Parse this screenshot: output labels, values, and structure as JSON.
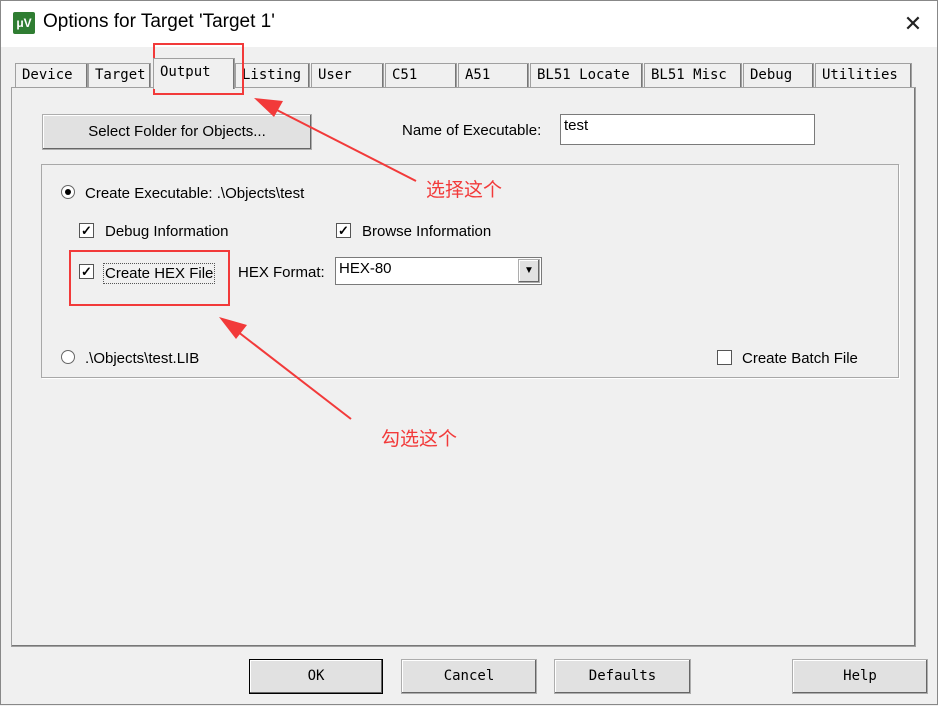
{
  "window": {
    "title": "Options for Target 'Target 1'",
    "icon": "uvision-icon",
    "close": "✕"
  },
  "tabs": [
    {
      "label": "Device",
      "selected": false
    },
    {
      "label": "Target",
      "selected": false
    },
    {
      "label": "Output",
      "selected": true
    },
    {
      "label": "Listing",
      "selected": false
    },
    {
      "label": "User",
      "selected": false
    },
    {
      "label": "C51",
      "selected": false
    },
    {
      "label": "A51",
      "selected": false
    },
    {
      "label": "BL51 Locate",
      "selected": false
    },
    {
      "label": "BL51 Misc",
      "selected": false
    },
    {
      "label": "Debug",
      "selected": false
    },
    {
      "label": "Utilities",
      "selected": false
    }
  ],
  "output": {
    "select_folder_label": "Select Folder for Objects...",
    "name_label": "Name of Executable:",
    "name_value": "test",
    "create_exe_label": "Create Executable:  .\\Objects\\test",
    "create_exe_selected": true,
    "debug_info_label": "Debug Information",
    "debug_info_checked": true,
    "browse_info_label": "Browse Information",
    "browse_info_checked": true,
    "create_hex_label": "Create HEX File",
    "create_hex_checked": true,
    "hex_format_label": "HEX Format:",
    "hex_format_value": "HEX-80",
    "lib_label": ".\\Objects\\test.LIB",
    "lib_selected": false,
    "batch_label": "Create Batch File",
    "batch_checked": false
  },
  "buttons": {
    "ok": "OK",
    "cancel": "Cancel",
    "defaults": "Defaults",
    "help": "Help"
  },
  "annotations": {
    "note1": "选择这个",
    "note2": "勾选这个",
    "color": "#f23a3a"
  }
}
